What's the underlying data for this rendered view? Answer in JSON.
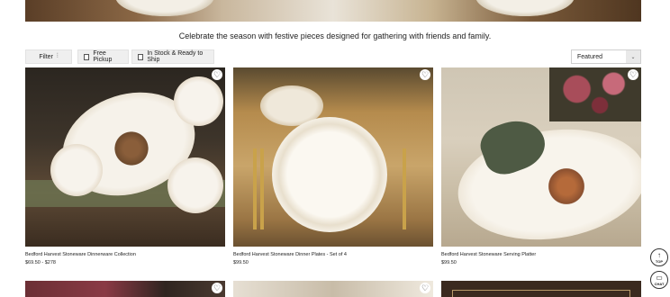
{
  "banner": {
    "tagline": "Celebrate the season with festive pieces designed for gathering with friends and family."
  },
  "filters": {
    "filter_label": "Filter",
    "filter_icon": "sliders-icon",
    "free_pickup_label": "Free Pickup",
    "in_stock_label": "In Stock & Ready to Ship",
    "sort_value": "Featured"
  },
  "products": [
    {
      "name": "Bedford Harvest Stoneware Dinnerware Collection",
      "price": "$69.50 - $278"
    },
    {
      "name": "Bedford Harvest Stoneware Dinner Plates - Set of 4",
      "price": "$99.50"
    },
    {
      "name": "Bedford Harvest Stoneware Serving Platter",
      "price": "$99.50"
    }
  ],
  "floating": {
    "top_label": "TOP",
    "chat_label": "CHAT"
  },
  "colors": {
    "chip_background": "#efefef",
    "text": "#222222"
  }
}
